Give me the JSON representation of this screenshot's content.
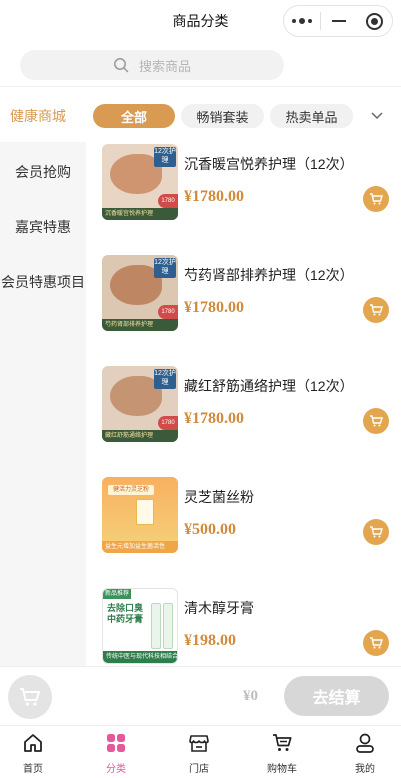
{
  "header": {
    "title": "商品分类"
  },
  "search": {
    "placeholder": "搜索商品"
  },
  "category_bar": {
    "current": "健康商城",
    "tabs": [
      {
        "label": "全部",
        "active": true
      },
      {
        "label": "畅销套装",
        "active": false
      },
      {
        "label": "热卖单品",
        "active": false
      }
    ]
  },
  "sidebar": {
    "items": [
      {
        "label": "会员抢购"
      },
      {
        "label": "嘉宾特惠"
      },
      {
        "label": "会员特惠项目"
      }
    ]
  },
  "products": [
    {
      "name": "沉香暖宫悦养护理（12次）",
      "price": "¥1780.00",
      "image_tag": "12次护理",
      "image_strip": "沉香暖宫悦养护理",
      "image_badge": "1780"
    },
    {
      "name": "芍药肾部排养护理（12次）",
      "price": "¥1780.00",
      "image_tag": "12次护理",
      "image_strip": "芍药肾部排养护理",
      "image_badge": "1780"
    },
    {
      "name": "藏红舒筋通络护理（12次）",
      "price": "¥1780.00",
      "image_tag": "12次护理",
      "image_strip": "藏红舒筋通络护理",
      "image_badge": "1780"
    },
    {
      "name": "灵芝菌丝粉",
      "price": "¥500.00",
      "image_banner": "健活力灵芝粉",
      "image_strip": "益生元增加益生菌活性"
    },
    {
      "name": "清木醇牙膏",
      "price": "¥198.00",
      "image_corner": "新品推荐",
      "image_title": "去除口臭 中药牙膏",
      "image_strip": "传统中医与现代科技相结合"
    }
  ],
  "checkout": {
    "total": "¥0",
    "button_label": "去结算"
  },
  "tabbar": {
    "items": [
      {
        "label": "首页",
        "icon": "home-icon"
      },
      {
        "label": "分类",
        "icon": "category-icon",
        "active": true
      },
      {
        "label": "门店",
        "icon": "store-icon"
      },
      {
        "label": "购物车",
        "icon": "cart-icon"
      },
      {
        "label": "我的",
        "icon": "user-icon"
      }
    ]
  },
  "colors": {
    "accent": "#d99a52",
    "price": "#d08a3a",
    "tab_active": "#e5589a",
    "cart_button": "#e3a64f"
  }
}
